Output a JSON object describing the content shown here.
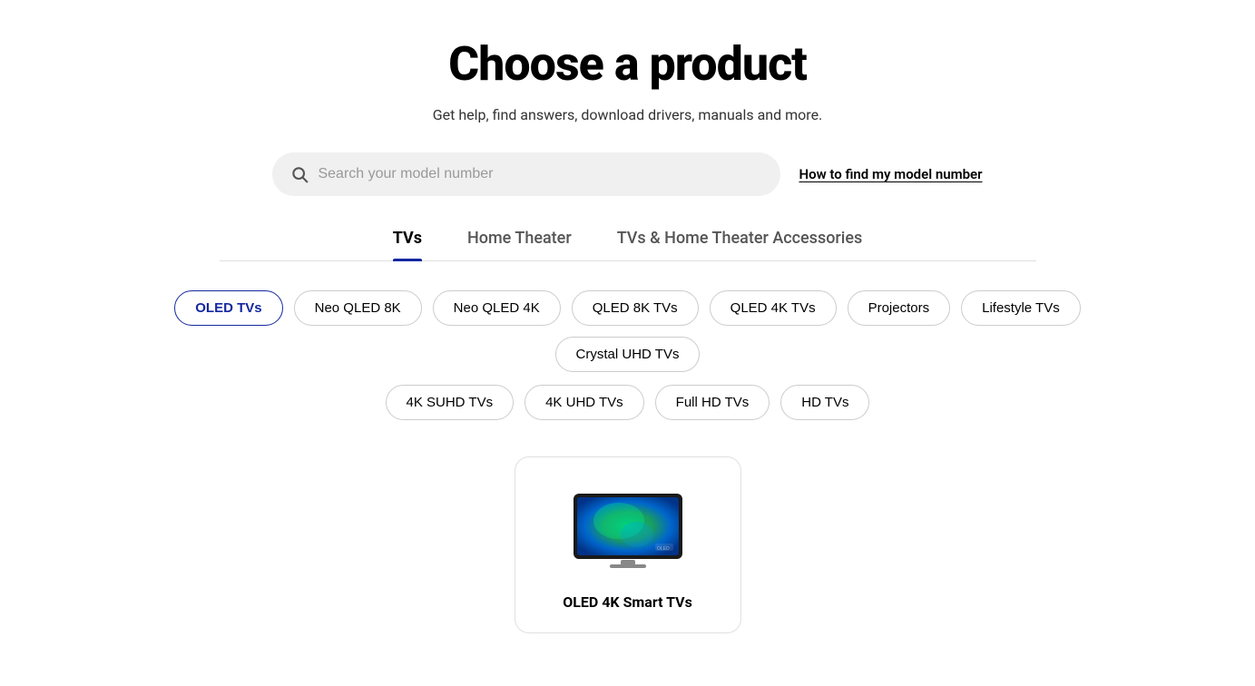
{
  "page": {
    "title": "Choose a product",
    "subtitle": "Get help, find answers, download drivers, manuals and more."
  },
  "search": {
    "placeholder": "Search your model number",
    "model_number_link": "How to find my model number"
  },
  "tabs": [
    {
      "id": "tvs",
      "label": "TVs",
      "active": true
    },
    {
      "id": "home-theater",
      "label": "Home Theater",
      "active": false
    },
    {
      "id": "accessories",
      "label": "TVs & Home Theater Accessories",
      "active": false
    }
  ],
  "filters_row1": [
    {
      "id": "oled-tvs",
      "label": "OLED TVs",
      "active": true
    },
    {
      "id": "neo-qled-8k",
      "label": "Neo QLED 8K",
      "active": false
    },
    {
      "id": "neo-qled-4k",
      "label": "Neo QLED 4K",
      "active": false
    },
    {
      "id": "qled-8k-tvs",
      "label": "QLED 8K TVs",
      "active": false
    },
    {
      "id": "qled-4k-tvs",
      "label": "QLED 4K TVs",
      "active": false
    },
    {
      "id": "projectors",
      "label": "Projectors",
      "active": false
    },
    {
      "id": "lifestyle-tvs",
      "label": "Lifestyle TVs",
      "active": false
    },
    {
      "id": "crystal-uhd-tvs",
      "label": "Crystal UHD TVs",
      "active": false
    }
  ],
  "filters_row2": [
    {
      "id": "4k-suhd-tvs",
      "label": "4K SUHD TVs",
      "active": false
    },
    {
      "id": "4k-uhd-tvs",
      "label": "4K UHD TVs",
      "active": false
    },
    {
      "id": "full-hd-tvs",
      "label": "Full HD TVs",
      "active": false
    },
    {
      "id": "hd-tvs",
      "label": "HD TVs",
      "active": false
    }
  ],
  "products": [
    {
      "id": "oled-4k-smart-tvs",
      "label": "OLED 4K Smart TVs"
    }
  ],
  "colors": {
    "active_blue": "#1428A0",
    "border_gray": "#e0e0e0"
  }
}
